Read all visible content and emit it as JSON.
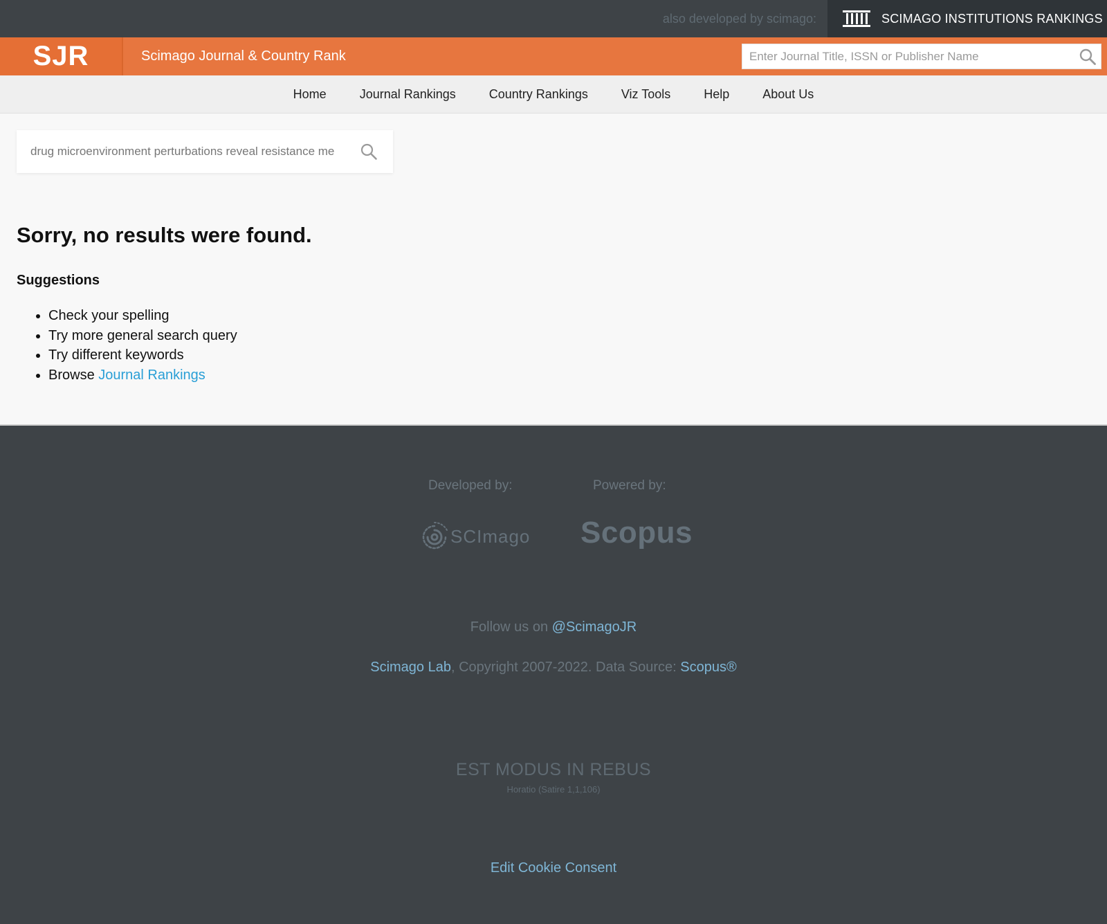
{
  "topbar": {
    "also_developed": "also developed by scimago:",
    "institutions_link": "SCIMAGO INSTITUTIONS RANKINGS",
    "institutions_icon": "institution-columns-icon"
  },
  "header": {
    "logo": "SJR",
    "site_title": "Scimago Journal & Country Rank",
    "search_placeholder": "Enter Journal Title, ISSN or Publisher Name",
    "search_icon": "search-icon",
    "colors": {
      "orange": "#e7763f",
      "dark": "#3e4347"
    }
  },
  "nav": {
    "items": [
      {
        "label": "Home"
      },
      {
        "label": "Journal Rankings"
      },
      {
        "label": "Country Rankings"
      },
      {
        "label": "Viz Tools"
      },
      {
        "label": "Help"
      },
      {
        "label": "About Us"
      }
    ]
  },
  "main": {
    "search_value": "drug microenvironment perturbations reveal resistance me",
    "no_results": "Sorry, no results were found.",
    "suggestions_title": "Suggestions",
    "suggestions": [
      {
        "text": "Check your spelling"
      },
      {
        "text": "Try more general search query"
      },
      {
        "text": "Try different keywords"
      },
      {
        "text": "Browse ",
        "link": "Journal Rankings"
      }
    ]
  },
  "footer": {
    "developed_by": "Developed by:",
    "powered_by": "Powered by:",
    "scimago_logo": "SCImago",
    "scopus_logo": "Scopus",
    "follow_prefix": "Follow us on ",
    "follow_handle": "@ScimagoJR",
    "lab_link": "Scimago Lab",
    "copyright": ", Copyright 2007-2022. Data Source: ",
    "scopus_link": "Scopus®",
    "motto": "EST MODUS IN REBUS",
    "motto_source": "Horatio (Satire 1,1,106)",
    "cookie": "Edit Cookie Consent"
  }
}
